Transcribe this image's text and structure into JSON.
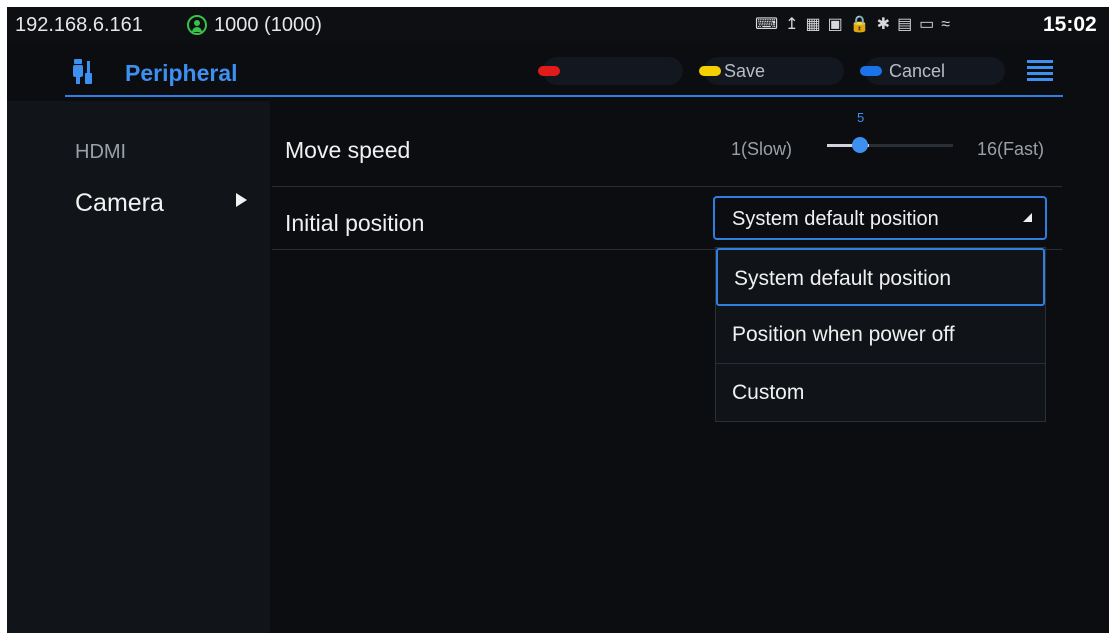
{
  "status_bar": {
    "ip": "192.168.6.161",
    "account": "1000 (1000)",
    "time": "15:02",
    "icons": [
      "network-icon",
      "upload-icon",
      "calendar-icon",
      "image-icon",
      "lock-icon",
      "bluetooth-icon",
      "storage-icon",
      "display-icon",
      "wifi-icon"
    ],
    "icon_glyphs": "⌨↥▦▣🔒✱▤▭≈"
  },
  "header": {
    "title": "Peripheral",
    "softkeys": {
      "red_label": "",
      "save_label": "Save",
      "cancel_label": "Cancel"
    }
  },
  "colors": {
    "accent": "#3d8ff0",
    "red": "#e11a1a",
    "yellow": "#f5d000",
    "blue": "#1a73e8",
    "status_green": "#38c24a"
  },
  "sidebar": {
    "items": [
      {
        "label": "HDMI",
        "selected": false
      },
      {
        "label": "Camera",
        "selected": true
      }
    ]
  },
  "settings": {
    "move_speed": {
      "label": "Move speed",
      "min_label": "1(Slow)",
      "max_label": "16(Fast)",
      "value": 5,
      "value_label": "5",
      "min": 1,
      "max": 16
    },
    "initial_position": {
      "label": "Initial position",
      "selected": "System default position",
      "options": [
        "System default position",
        "Position when power off",
        "Custom"
      ]
    }
  }
}
